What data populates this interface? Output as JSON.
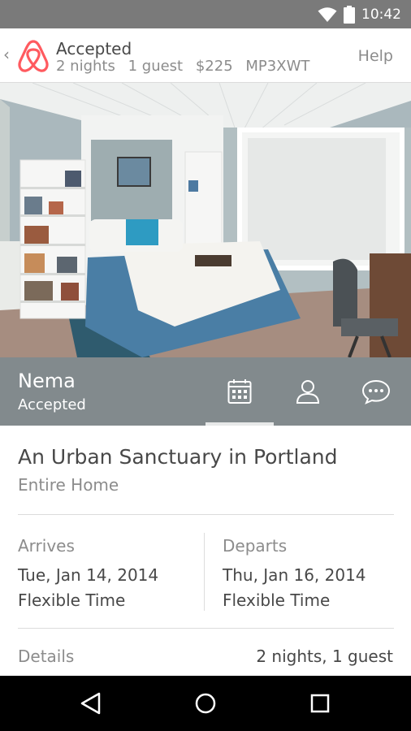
{
  "status_bar": {
    "time": "10:42",
    "icons": [
      "wifi-icon",
      "battery-icon"
    ]
  },
  "header": {
    "title": "Accepted",
    "nights": "2 nights",
    "guests": "1 guest",
    "price": "$225",
    "code": "MP3XWT",
    "help": "Help",
    "brand_color": "#ff5a5f"
  },
  "host": {
    "name": "Nema",
    "status": "Accepted"
  },
  "tabs": [
    {
      "icon": "calendar-icon",
      "active": true
    },
    {
      "icon": "user-icon",
      "active": false
    },
    {
      "icon": "message-icon",
      "active": false
    }
  ],
  "listing": {
    "title": "An Urban Sanctuary in Portland",
    "type": "Entire Home"
  },
  "arrives": {
    "label": "Arrives",
    "date": "Tue, Jan 14, 2014",
    "time": "Flexible Time"
  },
  "departs": {
    "label": "Departs",
    "date": "Thu, Jan 16, 2014",
    "time": "Flexible Time"
  },
  "details": {
    "label": "Details",
    "value": "2 nights, 1 guest"
  },
  "nav": [
    "back-icon",
    "home-icon",
    "recent-apps-icon"
  ]
}
